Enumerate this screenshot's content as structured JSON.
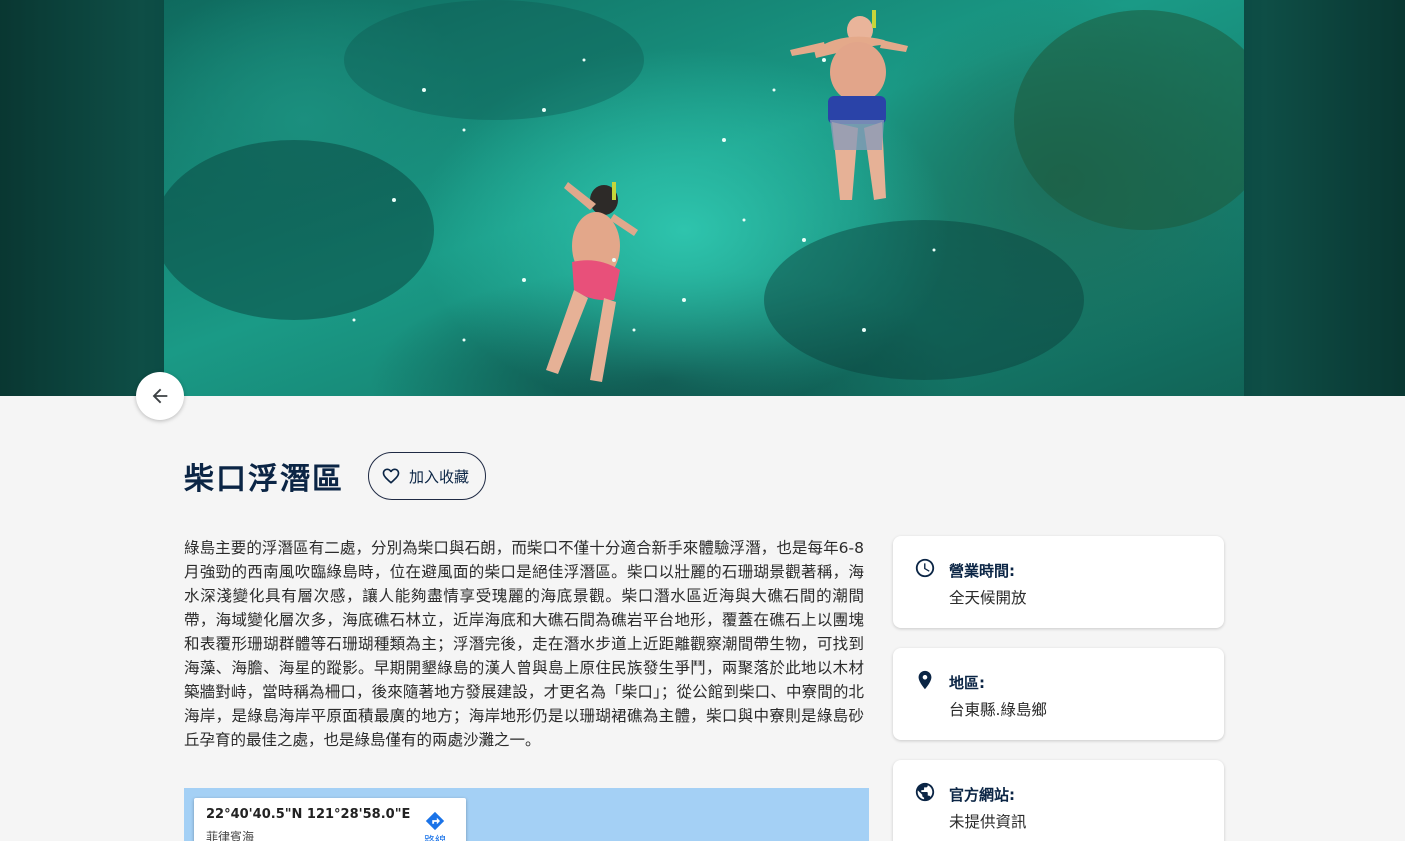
{
  "hero": {
    "image_alt": "snorkelers-in-clear-sea"
  },
  "back_button": {
    "icon": "arrow-left-icon"
  },
  "attraction": {
    "title": "柴口浮潛區",
    "favorite_label": "加入收藏",
    "description": "綠島主要的浮潛區有二處，分別為柴口與石朗，而柴口不僅十分適合新手來體驗浮潛，也是每年6-8月強勁的西南風吹臨綠島時，位在避風面的柴口是絕佳浮潛區。柴口以壯麗的石珊瑚景觀著稱，海水深淺變化具有層次感，讓人能夠盡情享受瑰麗的海底景觀。柴口潛水區近海與大礁石間的潮間帶，海域變化層次多，海底礁石林立，近岸海底和大礁石間為礁岩平台地形，覆蓋在礁石上以團塊和表覆形珊瑚群體等石珊瑚種類為主；浮潛完後，走在潛水步道上近距離觀察潮間帶生物，可找到海藻、海膽、海星的蹤影。早期開墾綠島的漢人曾與島上原住民族發生爭鬥，兩聚落於此地以木材築牆對峙，當時稱為柵口，後來隨著地方發展建設，才更名為「柴口」；從公館到柴口、中寮間的北海岸，是綠島海岸平原面積最廣的地方；海岸地形仍是以珊瑚裙礁為主體，柴口與中寮則是綠島砂丘孕育的最佳之處，也是綠島僅有的兩處沙灘之一。"
  },
  "map": {
    "coordinates": "22°40'40.5\"N 121°28'58.0\"E",
    "place": "菲律賓海",
    "directions_label": "路線"
  },
  "info": [
    {
      "icon": "clock-icon",
      "label": "營業時間:",
      "value": "全天候開放"
    },
    {
      "icon": "location-pin-icon",
      "label": "地區:",
      "value": "台東縣.綠島鄉"
    },
    {
      "icon": "globe-icon",
      "label": "官方網站:",
      "value": "未提供資訊"
    }
  ],
  "colors": {
    "title": "#0b2545",
    "background": "#f5f5f5",
    "map_water": "#a4d0f5",
    "link": "#1a73e8"
  }
}
